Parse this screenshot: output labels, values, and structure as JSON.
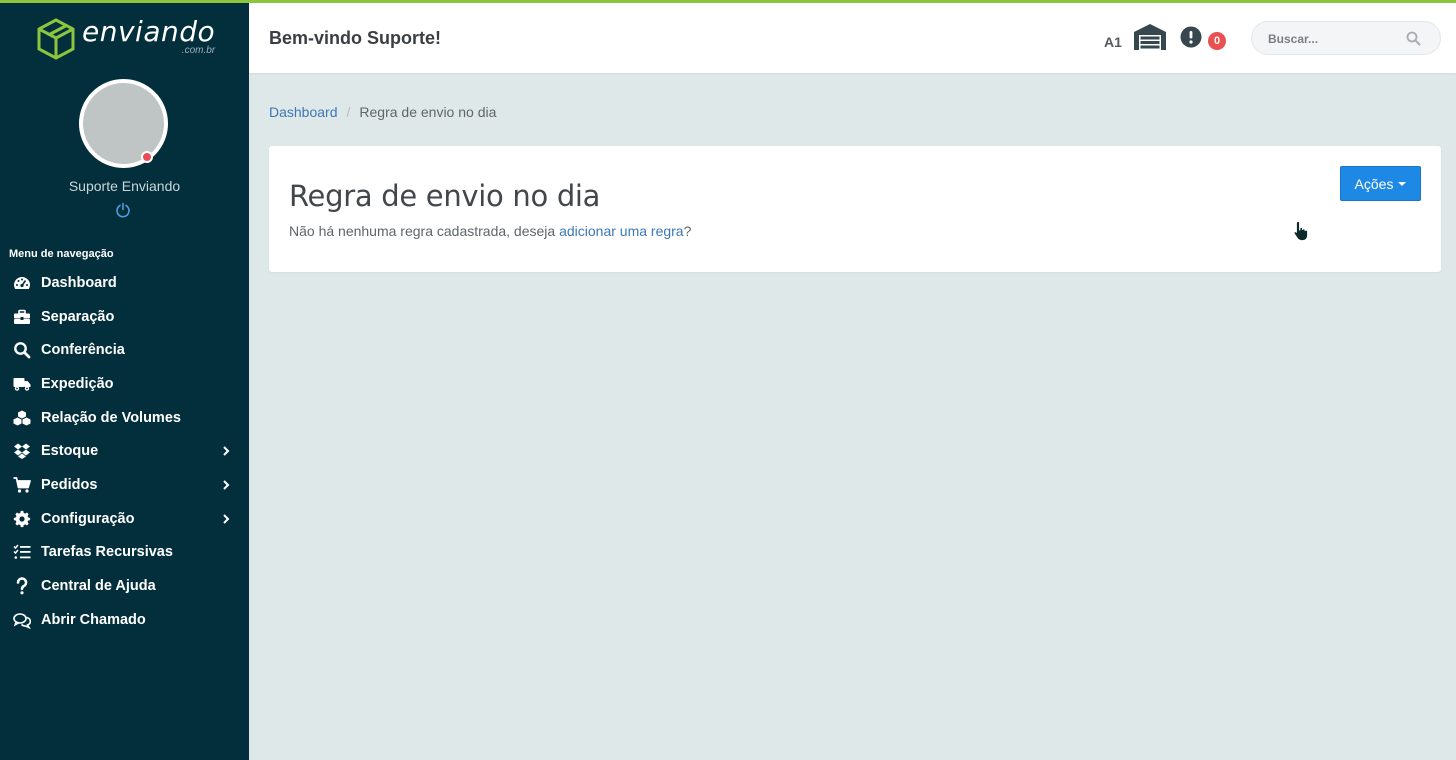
{
  "brand": {
    "name": "enviando",
    "sub": ".com.br",
    "color": "#8cc63f"
  },
  "user": {
    "name": "Suporte Enviando"
  },
  "nav": {
    "title": "Menu de navegação",
    "items": [
      {
        "label": "Dashboard",
        "icon": "dashboard-gauge-icon"
      },
      {
        "label": "Separação",
        "icon": "toolbox-icon"
      },
      {
        "label": "Conferência",
        "icon": "search-icon"
      },
      {
        "label": "Expedição",
        "icon": "truck-icon"
      },
      {
        "label": "Relação de Volumes",
        "icon": "cubes-icon"
      },
      {
        "label": "Estoque",
        "icon": "dropbox-icon",
        "has_submenu": true
      },
      {
        "label": "Pedidos",
        "icon": "cart-icon",
        "has_submenu": true
      },
      {
        "label": "Configuração",
        "icon": "gear-icon",
        "has_submenu": true
      },
      {
        "label": "Tarefas Recursivas",
        "icon": "task-list-icon"
      },
      {
        "label": "Central de Ajuda",
        "icon": "question-icon"
      },
      {
        "label": "Abrir Chamado",
        "icon": "chat-icon"
      }
    ]
  },
  "header": {
    "welcome": "Bem-vindo Suporte!",
    "warehouse_code": "A1",
    "alert_count": "0",
    "search_placeholder": "Buscar..."
  },
  "breadcrumb": {
    "home": "Dashboard",
    "separator": "/",
    "current": "Regra de envio no dia"
  },
  "card": {
    "title": "Regra de envio no dia",
    "text_before": "Não há nenhuma regra cadastrada, deseja ",
    "link": "adicionar uma regra",
    "text_after": "?",
    "actions_label": "Ações"
  },
  "colors": {
    "sidebar": "#032e3c",
    "accent": "#1e88e5",
    "badge": "#e95050",
    "link": "#3c78b5"
  }
}
